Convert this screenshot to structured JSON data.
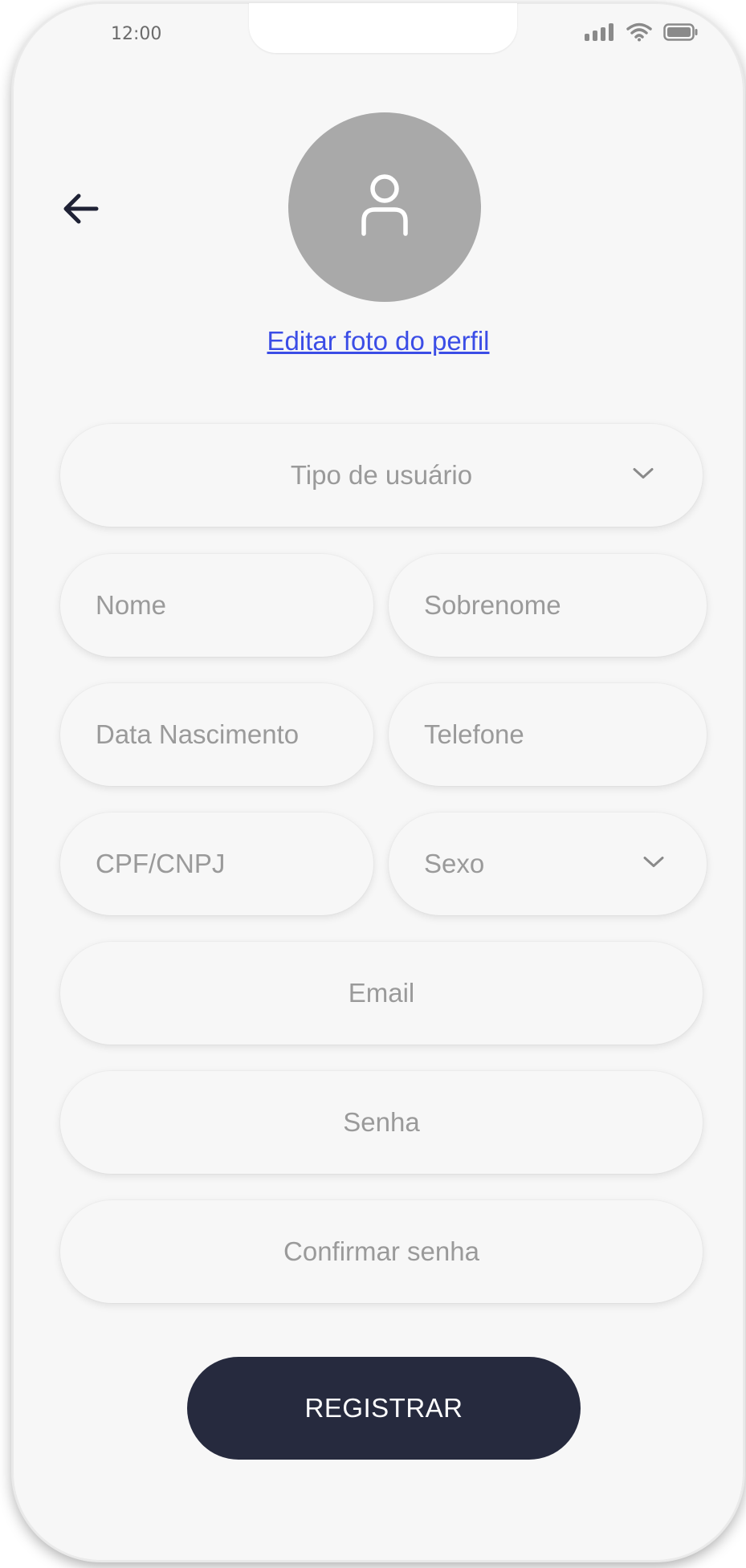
{
  "status_bar": {
    "time": "12:00",
    "icons": [
      "cellular-signal-icon",
      "wifi-icon",
      "battery-icon"
    ]
  },
  "header": {
    "back_icon": "arrow-left-icon",
    "avatar_icon": "user-icon",
    "edit_photo_label": "Editar foto do perfil"
  },
  "form": {
    "user_type": {
      "label": "Tipo de usuário",
      "icon": "chevron-down-icon"
    },
    "first_name": {
      "placeholder": "Nome",
      "value": ""
    },
    "last_name": {
      "placeholder": "Sobrenome",
      "value": ""
    },
    "birth_date": {
      "placeholder": "Data Nascimento",
      "value": ""
    },
    "phone": {
      "placeholder": "Telefone",
      "value": ""
    },
    "document": {
      "placeholder": "CPF/CNPJ",
      "value": ""
    },
    "sex": {
      "label": "Sexo",
      "icon": "chevron-down-icon"
    },
    "email": {
      "placeholder": "Email",
      "value": ""
    },
    "password": {
      "placeholder": "Senha",
      "value": ""
    },
    "confirm_password": {
      "placeholder": "Confirmar senha",
      "value": ""
    }
  },
  "actions": {
    "register_label": "REGISTRAR"
  },
  "colors": {
    "background": "#f7f7f7",
    "avatar": "#a9a9a9",
    "link": "#3b4de6",
    "primary_button": "#262a3e",
    "placeholder": "#9a9a9a"
  }
}
